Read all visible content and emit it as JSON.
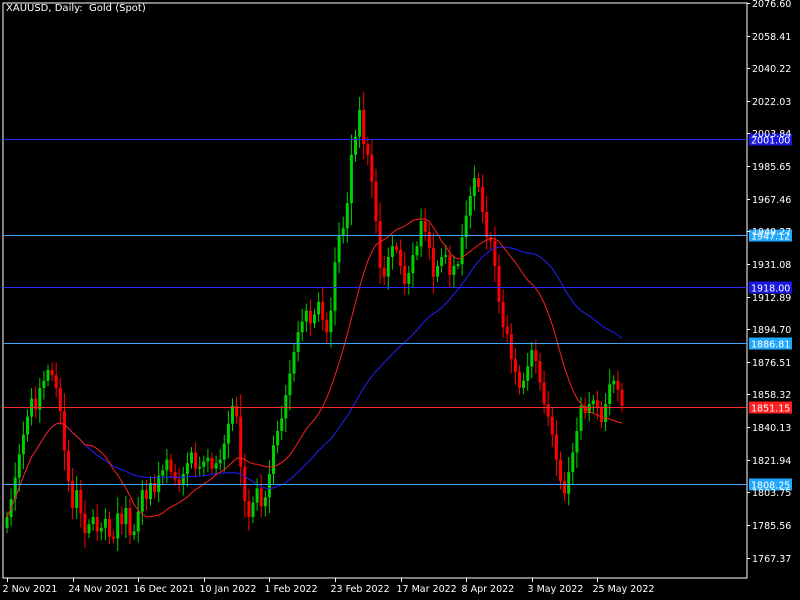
{
  "title": "XAUUSD, Daily:  Gold (Spot)",
  "colors": {
    "background": "#000000",
    "axis": "#ffffff",
    "bull": "#00d000",
    "bear": "#ff0000",
    "ma_fast": "#ff1e1e",
    "ma_slow": "#2020ff",
    "line_blue": "#2a2aff",
    "line_cyan": "#3fa7ff",
    "line_red": "#ff2a2a",
    "tag_blue": "#1818e0",
    "tag_cyan": "#20a8ff",
    "tag_red": "#ff2020"
  },
  "chart_data": {
    "type": "candlestick",
    "title": "XAUUSD, Daily:  Gold (Spot)",
    "ylim": [
      1756.0,
      2076.6
    ],
    "y_ticks": [
      "2076.60",
      "2058.41",
      "2040.22",
      "2022.03",
      "2003.84",
      "1985.65",
      "1967.46",
      "1949.27",
      "1931.08",
      "1912.89",
      "1894.70",
      "1876.51",
      "1858.32",
      "1840.13",
      "1821.94",
      "1803.75",
      "1785.56",
      "1767.37"
    ],
    "x_ticks": [
      {
        "label": "2 Nov 2021",
        "index": 0
      },
      {
        "label": "24 Nov 2021",
        "index": 16
      },
      {
        "label": "16 Dec 2021",
        "index": 32
      },
      {
        "label": "10 Jan 2022",
        "index": 48
      },
      {
        "label": "1 Feb 2022",
        "index": 64
      },
      {
        "label": "23 Feb 2022",
        "index": 80
      },
      {
        "label": "17 Mar 2022",
        "index": 96
      },
      {
        "label": "8 Apr 2022",
        "index": 112
      },
      {
        "label": "3 May 2022",
        "index": 128
      },
      {
        "label": "25 May 2022",
        "index": 144
      }
    ],
    "levels": [
      {
        "price": 2001.0,
        "label": "2001.00",
        "style": "blue"
      },
      {
        "price": 1947.12,
        "label": "1947.12",
        "style": "cyan"
      },
      {
        "price": 1918.0,
        "label": "1918.00",
        "style": "blue"
      },
      {
        "price": 1886.81,
        "label": "1886.81",
        "style": "cyan"
      },
      {
        "price": 1851.15,
        "label": "1851.15",
        "style": "red"
      },
      {
        "price": 1808.25,
        "label": "1808.25",
        "style": "cyan"
      }
    ],
    "closes": [
      1790,
      1800,
      1812,
      1825,
      1836,
      1846,
      1856,
      1850,
      1862,
      1866,
      1872,
      1869,
      1862,
      1849,
      1827,
      1810,
      1795,
      1805,
      1792,
      1781,
      1786,
      1790,
      1782,
      1784,
      1789,
      1779,
      1778,
      1792,
      1786,
      1795,
      1780,
      1782,
      1793,
      1805,
      1800,
      1809,
      1804,
      1813,
      1816,
      1822,
      1815,
      1811,
      1808,
      1814,
      1820,
      1826,
      1817,
      1818,
      1821,
      1823,
      1817,
      1820,
      1822,
      1831,
      1842,
      1852,
      1846,
      1818,
      1799,
      1790,
      1798,
      1806,
      1796,
      1801,
      1814,
      1830,
      1838,
      1845,
      1858,
      1870,
      1882,
      1893,
      1899,
      1905,
      1898,
      1903,
      1910,
      1900,
      1893,
      1905,
      1932,
      1947,
      1951,
      1965,
      1992,
      2002,
      2017,
      1998,
      1992,
      1977,
      1955,
      1929,
      1924,
      1935,
      1941,
      1939,
      1930,
      1920,
      1926,
      1936,
      1941,
      1955,
      1949,
      1940,
      1924,
      1930,
      1935,
      1936,
      1925,
      1930,
      1931,
      1946,
      1958,
      1969,
      1979,
      1974,
      1960,
      1946,
      1944,
      1930,
      1910,
      1896,
      1892,
      1878,
      1871,
      1862,
      1866,
      1874,
      1883,
      1877,
      1865,
      1853,
      1846,
      1836,
      1822,
      1810,
      1803,
      1815,
      1826,
      1838,
      1852,
      1848,
      1853,
      1855,
      1851,
      1843,
      1853,
      1864,
      1866,
      1861,
      1852
    ]
  }
}
